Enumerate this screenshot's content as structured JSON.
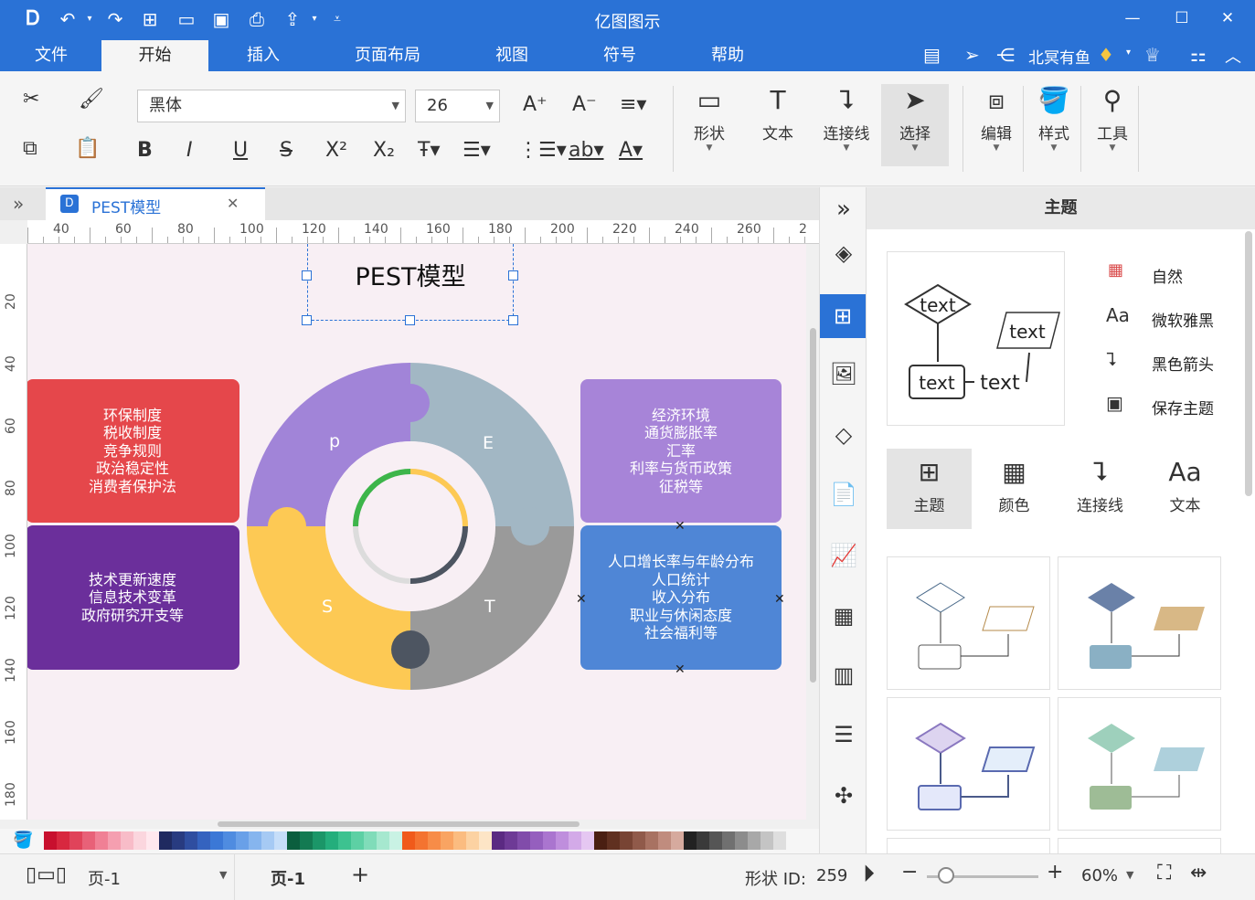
{
  "app": {
    "title": "亿图图示"
  },
  "menu": [
    "文件",
    "开始",
    "插入",
    "页面布局",
    "视图",
    "符号",
    "帮助"
  ],
  "user": {
    "name": "北冥有鱼"
  },
  "ribbon": {
    "font": "黑体",
    "size": "26",
    "big_buttons": [
      "形状",
      "文本",
      "连接线",
      "选择",
      "编辑",
      "样式",
      "工具"
    ]
  },
  "doc_tab": {
    "label": "PEST模型"
  },
  "ruler": {
    "top": [
      "40",
      "60",
      "80",
      "100",
      "120",
      "140",
      "160",
      "180",
      "200",
      "220",
      "240",
      "260",
      "2"
    ],
    "left": [
      "20",
      "40",
      "60",
      "80",
      "100",
      "120",
      "140",
      "160",
      "180"
    ]
  },
  "diagram": {
    "title": "PEST模型",
    "segments": {
      "p": "p",
      "e": "E",
      "s": "S",
      "t": "T"
    },
    "boxes": {
      "political": [
        "环保制度",
        "税收制度",
        "竞争规则",
        "政治稳定性",
        "消费者保护法"
      ],
      "technology": [
        "技术更新速度",
        "信息技术变革",
        "政府研究开支等"
      ],
      "economic": [
        "经济环境",
        "通货膨胀率",
        "汇率",
        "利率与货币政策",
        "征税等"
      ],
      "social": [
        "人口增长率与年龄分布",
        "人口统计",
        "收入分布",
        "职业与休闲态度",
        "社会福利等"
      ]
    },
    "colors": {
      "political": "#e5474b",
      "technology": "#6b2f9b",
      "economic": "#a784d8",
      "social": "#4f86d6",
      "p": "#a184d8",
      "e": "#a2b7c4",
      "s": "#fdc954",
      "t": "#9a9a9a"
    }
  },
  "panel": {
    "title": "主题",
    "preview_text": "text",
    "options": [
      "自然",
      "微软雅黑",
      "黑色箭头",
      "保存主题"
    ],
    "tabs": [
      "主题",
      "颜色",
      "连接线",
      "文本"
    ]
  },
  "status": {
    "page_dropdown": "页-1",
    "page_tab": "页-1",
    "add": "+",
    "shape_id_label": "形状 ID:",
    "shape_id": "259",
    "zoom": "60%"
  }
}
